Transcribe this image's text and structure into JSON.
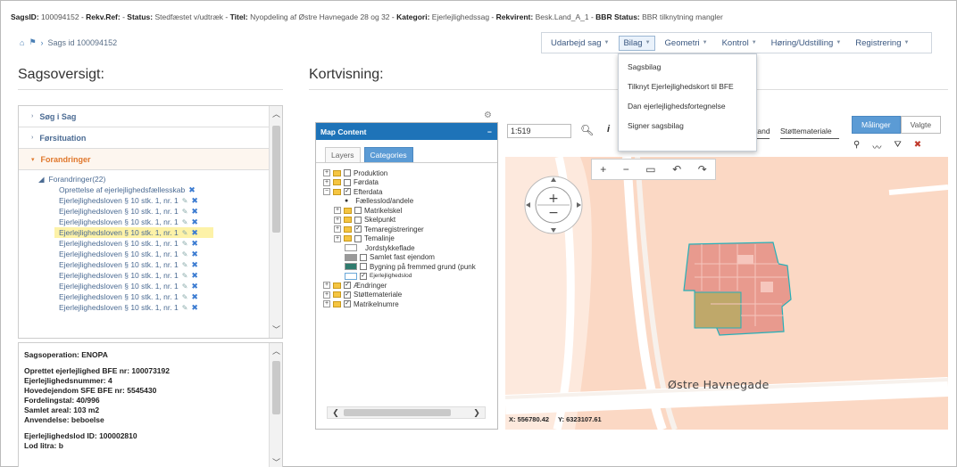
{
  "status_line": {
    "sagsid_label": "SagsID:",
    "sagsid": "100094152",
    "rekv_label": "Rekv.Ref:",
    "rekv": "",
    "status_label": "Status:",
    "status": "Stedfæstet v/udtræk",
    "titel_label": "Titel:",
    "titel": "Nyopdeling af Østre Havnegade 28 og 32",
    "kategori_label": "Kategori:",
    "kategori": "Ejerlejlighedssag",
    "rekvirent_label": "Rekvirent:",
    "rekvirent": "Besk.Land_A_1",
    "bbr_label": "BBR Status:",
    "bbr": "BBR tilknytning mangler"
  },
  "breadcrumb": {
    "label": "Sags id 100094152"
  },
  "menu": {
    "items": [
      {
        "label": "Udarbejd sag"
      },
      {
        "label": "Bilag"
      },
      {
        "label": "Geometri"
      },
      {
        "label": "Kontrol"
      },
      {
        "label": "Høring/Udstilling"
      },
      {
        "label": "Registrering"
      }
    ],
    "dropdown": [
      {
        "label": "Sagsbilag"
      },
      {
        "label": "Tilknyt Ejerlejlighedskort til BFE"
      },
      {
        "label": "Dan ejerlejlighedsfortegnelse"
      },
      {
        "label": "Signer sagsbilag"
      }
    ]
  },
  "headings": {
    "left": "Sagsoversigt:",
    "right": "Kortvisning:"
  },
  "accordion": [
    {
      "label": "Søg i Sag"
    },
    {
      "label": "Førsituation"
    },
    {
      "label": "Forandringer"
    }
  ],
  "tree": {
    "root": "Forandringer(22)",
    "items": [
      {
        "label": "Oprettelse af ejerlejlighedsfællesskab"
      },
      {
        "label": "Ejerlejlighedsloven § 10 stk. 1, nr. 1"
      },
      {
        "label": "Ejerlejlighedsloven § 10 stk. 1, nr. 1"
      },
      {
        "label": "Ejerlejlighedsloven § 10 stk. 1, nr. 1"
      },
      {
        "label": "Ejerlejlighedsloven § 10 stk. 1, nr. 1"
      },
      {
        "label": "Ejerlejlighedsloven § 10 stk. 1, nr. 1"
      },
      {
        "label": "Ejerlejlighedsloven § 10 stk. 1, nr. 1"
      },
      {
        "label": "Ejerlejlighedsloven § 10 stk. 1, nr. 1"
      },
      {
        "label": "Ejerlejlighedsloven § 10 stk. 1, nr. 1"
      },
      {
        "label": "Ejerlejlighedsloven § 10 stk. 1, nr. 1"
      },
      {
        "label": "Ejerlejlighedsloven § 10 stk. 1, nr. 1"
      },
      {
        "label": "Ejerlejlighedsloven § 10 stk. 1, nr. 1"
      }
    ]
  },
  "info": {
    "lines": [
      "Sagsoperation: ENOPA",
      "",
      "Oprettet ejerlejlighed BFE nr: 100073192",
      "Ejerlejlighedsnummer: 4",
      "Hovedejendom SFE BFE nr: 5545430",
      "Fordelingstal: 40/996",
      "Samlet areal: 103 m2",
      "Anvendelse: beboelse",
      "",
      "Ejerlejlighedslod ID: 100002810",
      "Lod litra: b"
    ]
  },
  "map_content": {
    "title": "Map Content",
    "tabs": [
      {
        "label": "Layers"
      },
      {
        "label": "Categories"
      }
    ],
    "layers": [
      {
        "label": "Produktion"
      },
      {
        "label": "Førdata"
      },
      {
        "label": "Efterdata"
      },
      {
        "label": "Fællesslod/andele"
      },
      {
        "label": "Matrikelskel"
      },
      {
        "label": "Skelpunkt"
      },
      {
        "label": "Temaregistreringer"
      },
      {
        "label": "Temalinje"
      },
      {
        "label": "Jordstykkeflade"
      },
      {
        "label": "Samlet fast ejendom"
      },
      {
        "label": "Bygning på fremmed grund (punk"
      },
      {
        "label": "Ejerlejlighedslod"
      },
      {
        "label": "Ændringer"
      },
      {
        "label": "Støttemateriale"
      },
      {
        "label": "Matrikelnumre"
      }
    ]
  },
  "map_toolbar": {
    "scale_prefix": "1:",
    "scale": "519",
    "tand_label": "tand",
    "stotte_label": "Støttemateriale",
    "tabs": [
      {
        "label": "Målinger"
      },
      {
        "label": "Valgte"
      }
    ]
  },
  "map": {
    "street": "Østre Havnegade",
    "x": "X: 556780.42",
    "y": "Y: 6323107.61"
  },
  "colors": {
    "accent_blue": "#1e73b8",
    "accent_orange": "#e0782c",
    "map_fill": "#fbd8c4",
    "highlight": "#fdf2a8"
  }
}
